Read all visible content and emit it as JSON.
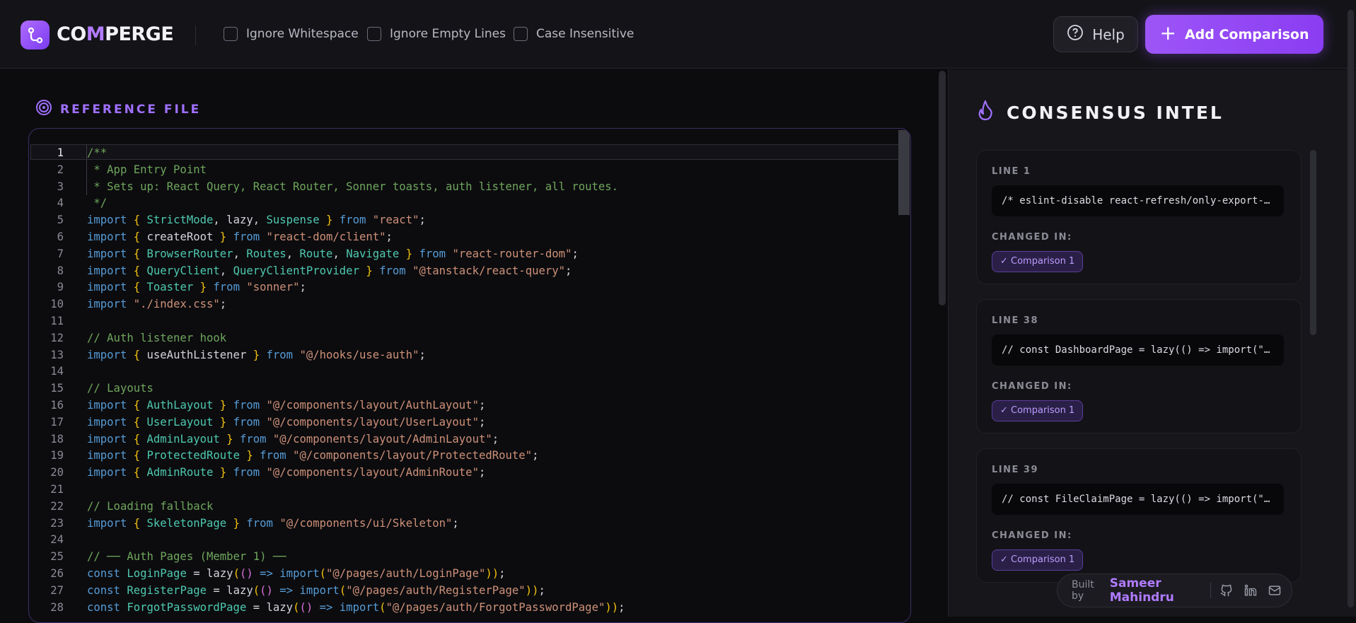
{
  "app": {
    "logo_pre": "CO",
    "logo_accent": "M",
    "logo_post": "PERGE"
  },
  "options": [
    {
      "label": "Ignore Whitespace",
      "checked": false
    },
    {
      "label": "Ignore Empty Lines",
      "checked": false
    },
    {
      "label": "Case Insensitive",
      "checked": false
    }
  ],
  "header": {
    "help_label": "Help",
    "add_label": "Add Comparison"
  },
  "reference": {
    "title": "REFERENCE FILE",
    "active_line": 1
  },
  "code_lines": [
    [
      [
        "cmt",
        "/**"
      ]
    ],
    [
      [
        "cmt",
        " * App Entry Point"
      ]
    ],
    [
      [
        "cmt",
        " * Sets up: React Query, React Router, Sonner toasts, auth listener, all routes."
      ]
    ],
    [
      [
        "cmt",
        " */"
      ]
    ],
    [
      [
        "kw",
        "import"
      ],
      [
        "t",
        " "
      ],
      [
        "br",
        "{"
      ],
      [
        "t",
        " "
      ],
      [
        "id",
        "StrictMode"
      ],
      [
        "t",
        ", lazy, "
      ],
      [
        "id",
        "Suspense"
      ],
      [
        "t",
        " "
      ],
      [
        "br",
        "}"
      ],
      [
        "t",
        " "
      ],
      [
        "kw",
        "from"
      ],
      [
        "t",
        " "
      ],
      [
        "str",
        "\"react\""
      ],
      [
        "t",
        ";"
      ]
    ],
    [
      [
        "kw",
        "import"
      ],
      [
        "t",
        " "
      ],
      [
        "br",
        "{"
      ],
      [
        "t",
        " createRoot "
      ],
      [
        "br",
        "}"
      ],
      [
        "t",
        " "
      ],
      [
        "kw",
        "from"
      ],
      [
        "t",
        " "
      ],
      [
        "str",
        "\"react-dom/client\""
      ],
      [
        "t",
        ";"
      ]
    ],
    [
      [
        "kw",
        "import"
      ],
      [
        "t",
        " "
      ],
      [
        "br",
        "{"
      ],
      [
        "t",
        " "
      ],
      [
        "id",
        "BrowserRouter"
      ],
      [
        "t",
        ", "
      ],
      [
        "id",
        "Routes"
      ],
      [
        "t",
        ", "
      ],
      [
        "id",
        "Route"
      ],
      [
        "t",
        ", "
      ],
      [
        "id",
        "Navigate"
      ],
      [
        "t",
        " "
      ],
      [
        "br",
        "}"
      ],
      [
        "t",
        " "
      ],
      [
        "kw",
        "from"
      ],
      [
        "t",
        " "
      ],
      [
        "str",
        "\"react-router-dom\""
      ],
      [
        "t",
        ";"
      ]
    ],
    [
      [
        "kw",
        "import"
      ],
      [
        "t",
        " "
      ],
      [
        "br",
        "{"
      ],
      [
        "t",
        " "
      ],
      [
        "id",
        "QueryClient"
      ],
      [
        "t",
        ", "
      ],
      [
        "id",
        "QueryClientProvider"
      ],
      [
        "t",
        " "
      ],
      [
        "br",
        "}"
      ],
      [
        "t",
        " "
      ],
      [
        "kw",
        "from"
      ],
      [
        "t",
        " "
      ],
      [
        "str",
        "\"@tanstack/react-query\""
      ],
      [
        "t",
        ";"
      ]
    ],
    [
      [
        "kw",
        "import"
      ],
      [
        "t",
        " "
      ],
      [
        "br",
        "{"
      ],
      [
        "t",
        " "
      ],
      [
        "id",
        "Toaster"
      ],
      [
        "t",
        " "
      ],
      [
        "br",
        "}"
      ],
      [
        "t",
        " "
      ],
      [
        "kw",
        "from"
      ],
      [
        "t",
        " "
      ],
      [
        "str",
        "\"sonner\""
      ],
      [
        "t",
        ";"
      ]
    ],
    [
      [
        "kw",
        "import"
      ],
      [
        "t",
        " "
      ],
      [
        "str",
        "\"./index.css\""
      ],
      [
        "t",
        ";"
      ]
    ],
    [],
    [
      [
        "cmt",
        "// Auth listener hook"
      ]
    ],
    [
      [
        "kw",
        "import"
      ],
      [
        "t",
        " "
      ],
      [
        "br",
        "{"
      ],
      [
        "t",
        " useAuthListener "
      ],
      [
        "br",
        "}"
      ],
      [
        "t",
        " "
      ],
      [
        "kw",
        "from"
      ],
      [
        "t",
        " "
      ],
      [
        "str",
        "\"@/hooks/use-auth\""
      ],
      [
        "t",
        ";"
      ]
    ],
    [],
    [
      [
        "cmt",
        "// Layouts"
      ]
    ],
    [
      [
        "kw",
        "import"
      ],
      [
        "t",
        " "
      ],
      [
        "br",
        "{"
      ],
      [
        "t",
        " "
      ],
      [
        "id",
        "AuthLayout"
      ],
      [
        "t",
        " "
      ],
      [
        "br",
        "}"
      ],
      [
        "t",
        " "
      ],
      [
        "kw",
        "from"
      ],
      [
        "t",
        " "
      ],
      [
        "str",
        "\"@/components/layout/AuthLayout\""
      ],
      [
        "t",
        ";"
      ]
    ],
    [
      [
        "kw",
        "import"
      ],
      [
        "t",
        " "
      ],
      [
        "br",
        "{"
      ],
      [
        "t",
        " "
      ],
      [
        "id",
        "UserLayout"
      ],
      [
        "t",
        " "
      ],
      [
        "br",
        "}"
      ],
      [
        "t",
        " "
      ],
      [
        "kw",
        "from"
      ],
      [
        "t",
        " "
      ],
      [
        "str",
        "\"@/components/layout/UserLayout\""
      ],
      [
        "t",
        ";"
      ]
    ],
    [
      [
        "kw",
        "import"
      ],
      [
        "t",
        " "
      ],
      [
        "br",
        "{"
      ],
      [
        "t",
        " "
      ],
      [
        "id",
        "AdminLayout"
      ],
      [
        "t",
        " "
      ],
      [
        "br",
        "}"
      ],
      [
        "t",
        " "
      ],
      [
        "kw",
        "from"
      ],
      [
        "t",
        " "
      ],
      [
        "str",
        "\"@/components/layout/AdminLayout\""
      ],
      [
        "t",
        ";"
      ]
    ],
    [
      [
        "kw",
        "import"
      ],
      [
        "t",
        " "
      ],
      [
        "br",
        "{"
      ],
      [
        "t",
        " "
      ],
      [
        "id",
        "ProtectedRoute"
      ],
      [
        "t",
        " "
      ],
      [
        "br",
        "}"
      ],
      [
        "t",
        " "
      ],
      [
        "kw",
        "from"
      ],
      [
        "t",
        " "
      ],
      [
        "str",
        "\"@/components/layout/ProtectedRoute\""
      ],
      [
        "t",
        ";"
      ]
    ],
    [
      [
        "kw",
        "import"
      ],
      [
        "t",
        " "
      ],
      [
        "br",
        "{"
      ],
      [
        "t",
        " "
      ],
      [
        "id",
        "AdminRoute"
      ],
      [
        "t",
        " "
      ],
      [
        "br",
        "}"
      ],
      [
        "t",
        " "
      ],
      [
        "kw",
        "from"
      ],
      [
        "t",
        " "
      ],
      [
        "str",
        "\"@/components/layout/AdminRoute\""
      ],
      [
        "t",
        ";"
      ]
    ],
    [],
    [
      [
        "cmt",
        "// Loading fallback"
      ]
    ],
    [
      [
        "kw",
        "import"
      ],
      [
        "t",
        " "
      ],
      [
        "br",
        "{"
      ],
      [
        "t",
        " "
      ],
      [
        "id",
        "SkeletonPage"
      ],
      [
        "t",
        " "
      ],
      [
        "br",
        "}"
      ],
      [
        "t",
        " "
      ],
      [
        "kw",
        "from"
      ],
      [
        "t",
        " "
      ],
      [
        "str",
        "\"@/components/ui/Skeleton\""
      ],
      [
        "t",
        ";"
      ]
    ],
    [],
    [
      [
        "cmt",
        "// ── Auth Pages (Member 1) ──"
      ]
    ],
    [
      [
        "kw",
        "const"
      ],
      [
        "t",
        " "
      ],
      [
        "id",
        "LoginPage"
      ],
      [
        "t",
        " = lazy"
      ],
      [
        "br",
        "("
      ],
      [
        "br2",
        "()"
      ],
      [
        "t",
        " "
      ],
      [
        "kw",
        "=>"
      ],
      [
        "t",
        " "
      ],
      [
        "kw",
        "import"
      ],
      [
        "br",
        "("
      ],
      [
        "str",
        "\"@/pages/auth/LoginPage\""
      ],
      [
        "br",
        "))"
      ],
      [
        "t",
        ";"
      ]
    ],
    [
      [
        "kw",
        "const"
      ],
      [
        "t",
        " "
      ],
      [
        "id",
        "RegisterPage"
      ],
      [
        "t",
        " = lazy"
      ],
      [
        "br",
        "("
      ],
      [
        "br2",
        "()"
      ],
      [
        "t",
        " "
      ],
      [
        "kw",
        "=>"
      ],
      [
        "t",
        " "
      ],
      [
        "kw",
        "import"
      ],
      [
        "br",
        "("
      ],
      [
        "str",
        "\"@/pages/auth/RegisterPage\""
      ],
      [
        "br",
        "))"
      ],
      [
        "t",
        ";"
      ]
    ],
    [
      [
        "kw",
        "const"
      ],
      [
        "t",
        " "
      ],
      [
        "id",
        "ForgotPasswordPage"
      ],
      [
        "t",
        " = lazy"
      ],
      [
        "br",
        "("
      ],
      [
        "br2",
        "()"
      ],
      [
        "t",
        " "
      ],
      [
        "kw",
        "=>"
      ],
      [
        "t",
        " "
      ],
      [
        "kw",
        "import"
      ],
      [
        "br",
        "("
      ],
      [
        "str",
        "\"@/pages/auth/ForgotPasswordPage\""
      ],
      [
        "br",
        "))"
      ],
      [
        "t",
        ";"
      ]
    ]
  ],
  "intel": {
    "title": "CONSENSUS INTEL",
    "cards": [
      {
        "line_label": "LINE 1",
        "snippet": "/* eslint-disable react-refresh/only-export-components */",
        "changed_label": "CHANGED IN:",
        "badge": "✓ Comparison 1"
      },
      {
        "line_label": "LINE 38",
        "snippet": "// const DashboardPage = lazy(() => import(\"@/pages/DashboardPage\"));",
        "changed_label": "CHANGED IN:",
        "badge": "✓ Comparison 1"
      },
      {
        "line_label": "LINE 39",
        "snippet": "// const FileClaimPage = lazy(() => import(\"@/pages/FileClaimPage\"));",
        "changed_label": "CHANGED IN:",
        "badge": "✓ Comparison 1"
      }
    ]
  },
  "footer": {
    "built_by": "Built by",
    "author": "Sameer Mahindru"
  },
  "icons": [
    "logo-icon",
    "help-icon",
    "plus-icon",
    "target-icon",
    "flame-icon",
    "github-icon",
    "linkedin-icon",
    "mail-icon"
  ],
  "colors": {
    "accent": "#9d55f7",
    "badge_bg": "#2a1f46",
    "comment": "#6fa65c",
    "keyword": "#569cd6",
    "string": "#ce9178"
  }
}
